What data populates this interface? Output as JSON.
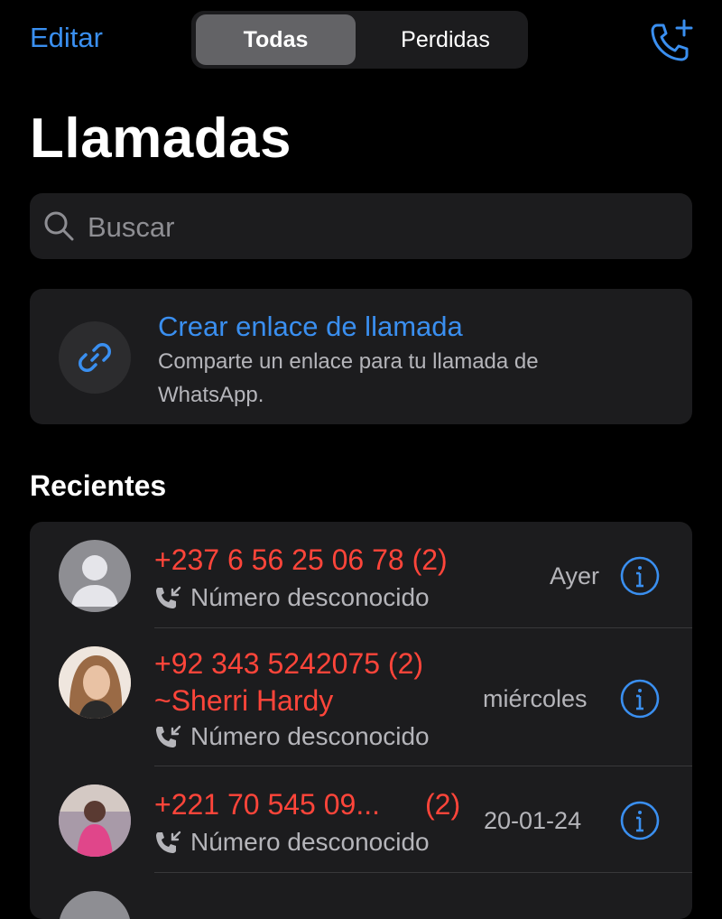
{
  "header": {
    "edit_label": "Editar",
    "tabs": [
      {
        "label": "Todas",
        "active": true
      },
      {
        "label": "Perdidas",
        "active": false
      }
    ],
    "new_call_icon": "phone-plus-icon"
  },
  "title": "Llamadas",
  "search": {
    "placeholder": "Buscar",
    "value": ""
  },
  "call_link": {
    "title": "Crear enlace de llamada",
    "description": "Comparte un enlace para tu llamada de WhatsApp.",
    "icon": "link-icon"
  },
  "recents": {
    "section_title": "Recientes",
    "items": [
      {
        "number": "+237 6 56 25 06 78 (2)",
        "name": "",
        "status": "Número desconocido",
        "date": "Ayer",
        "avatar": "default-person"
      },
      {
        "number": "+92 343 5242075 (2)",
        "name": "~Sherri Hardy",
        "status": "Número desconocido",
        "date": "miércoles",
        "avatar": "photo"
      },
      {
        "number": "+221 70 545 09...",
        "count": "(2)",
        "name": "",
        "status": "Número desconocido",
        "date": "20-01-24",
        "avatar": "photo"
      }
    ]
  },
  "colors": {
    "accent": "#3a8ff0",
    "missed": "#ff453a",
    "card": "#1c1c1e",
    "secondary_text": "#b5b5ba"
  }
}
